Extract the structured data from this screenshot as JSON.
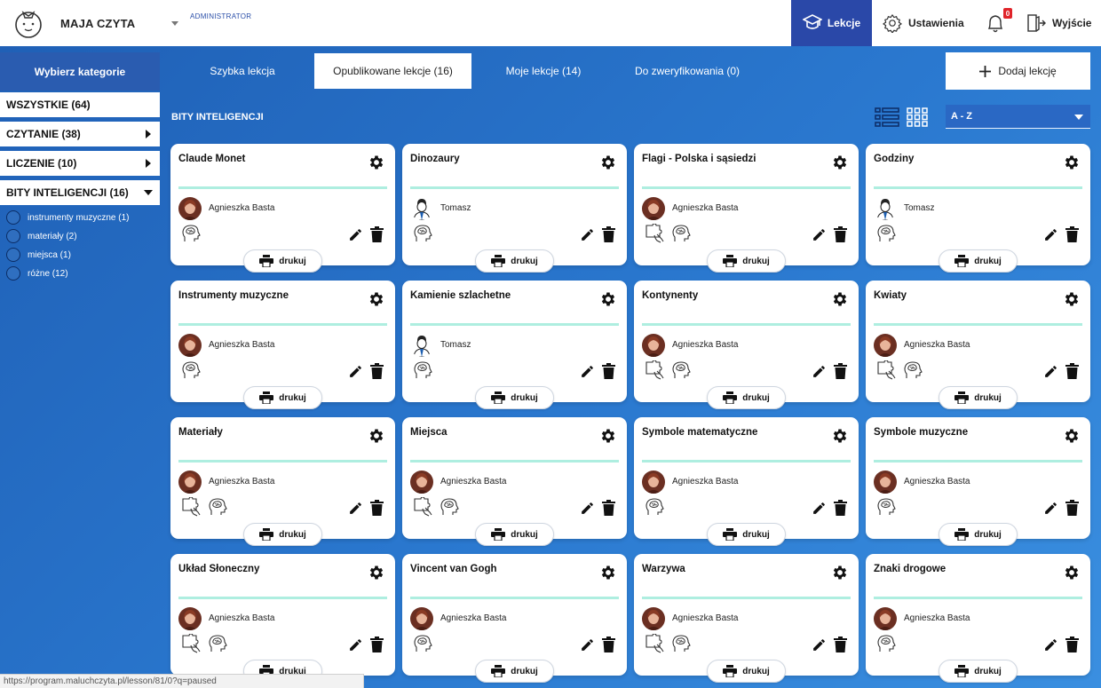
{
  "header": {
    "brand": "MAJA CZYTA",
    "role": "ADMINISTRATOR",
    "nav": {
      "lessons": "Lekcje",
      "settings": "Ustawienia",
      "notifications_count": "0",
      "exit": "Wyjście"
    }
  },
  "sidebar": {
    "title": "Wybierz kategorie",
    "categories": [
      {
        "label": "WSZYSTKIE (64)",
        "arrow": "none"
      },
      {
        "label": "CZYTANIE (38)",
        "arrow": "right"
      },
      {
        "label": "LICZENIE (10)",
        "arrow": "right"
      },
      {
        "label": "BITY INTELIGENCJI (16)",
        "arrow": "down"
      }
    ],
    "subcategories": [
      "instrumenty muzyczne (1)",
      "materiały (2)",
      "miejsca (1)",
      "różne (12)"
    ]
  },
  "tabs": [
    "Szybka lekcja",
    "Opublikowane lekcje (16)",
    "Moje lekcje (14)",
    "Do zweryfikowania (0)"
  ],
  "add_button": "Dodaj lekcję",
  "section_title": "BITY INTELIGENCJI",
  "sort": {
    "selected": "A - Z"
  },
  "print_label": "drukuj",
  "cards": [
    {
      "title": "Claude Monet",
      "author": "Agnieszka Basta",
      "avatar": "woman",
      "icons": [
        "brain"
      ]
    },
    {
      "title": "Dinozaury",
      "author": "Tomasz",
      "avatar": "man",
      "icons": [
        "brain"
      ]
    },
    {
      "title": "Flagi - Polska i sąsiedzi",
      "author": "Agnieszka Basta",
      "avatar": "woman",
      "icons": [
        "puzzle",
        "brain"
      ]
    },
    {
      "title": "Godziny",
      "author": "Tomasz",
      "avatar": "man",
      "icons": [
        "brain"
      ]
    },
    {
      "title": "Instrumenty muzyczne",
      "author": "Agnieszka Basta",
      "avatar": "woman",
      "icons": [
        "brain"
      ]
    },
    {
      "title": "Kamienie szlachetne",
      "author": "Tomasz",
      "avatar": "man",
      "icons": [
        "brain"
      ]
    },
    {
      "title": "Kontynenty",
      "author": "Agnieszka Basta",
      "avatar": "woman",
      "icons": [
        "puzzle",
        "brain"
      ]
    },
    {
      "title": "Kwiaty",
      "author": "Agnieszka Basta",
      "avatar": "woman",
      "icons": [
        "puzzle",
        "brain"
      ]
    },
    {
      "title": "Materiały",
      "author": "Agnieszka Basta",
      "avatar": "woman",
      "icons": [
        "puzzle",
        "brain"
      ]
    },
    {
      "title": "Miejsca",
      "author": "Agnieszka Basta",
      "avatar": "woman",
      "icons": [
        "puzzle",
        "brain"
      ]
    },
    {
      "title": "Symbole matematyczne",
      "author": "Agnieszka Basta",
      "avatar": "woman",
      "icons": [
        "brain"
      ]
    },
    {
      "title": "Symbole muzyczne",
      "author": "Agnieszka Basta",
      "avatar": "woman",
      "icons": [
        "brain"
      ]
    },
    {
      "title": "Układ Słoneczny",
      "author": "Agnieszka Basta",
      "avatar": "woman",
      "icons": [
        "puzzle",
        "brain"
      ]
    },
    {
      "title": "Vincent van Gogh",
      "author": "Agnieszka Basta",
      "avatar": "woman",
      "icons": [
        "brain"
      ]
    },
    {
      "title": "Warzywa",
      "author": "Agnieszka Basta",
      "avatar": "woman",
      "icons": [
        "puzzle",
        "brain"
      ]
    },
    {
      "title": "Znaki drogowe",
      "author": "Agnieszka Basta",
      "avatar": "woman",
      "icons": [
        "brain"
      ]
    }
  ],
  "status_url": "https://program.maluchczyta.pl/lesson/81/0?q=paused",
  "colors": {
    "accent": "#2a48a8",
    "progress_bar": "#aeeee0",
    "badge": "#e0242a"
  }
}
